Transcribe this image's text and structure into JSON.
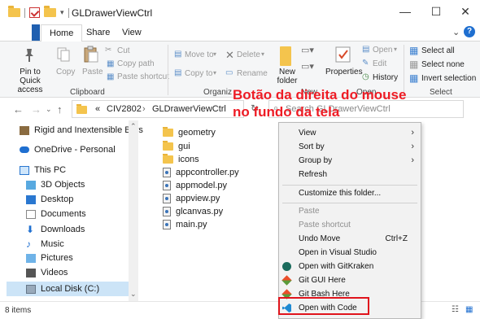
{
  "window": {
    "title": "GLDrawerViewCtrl",
    "controls": [
      "—",
      "☐",
      "✕"
    ]
  },
  "tabs": {
    "home": "Home",
    "share": "Share",
    "view": "View"
  },
  "ribbon": {
    "pin": "Pin to Quick access",
    "copy": "Copy",
    "paste": "Paste",
    "cut": "Cut",
    "copy_path": "Copy path",
    "paste_shortcut": "Paste shortcut",
    "move_to": "Move to",
    "copy_to": "Copy to",
    "delete": "Delete",
    "rename": "Rename",
    "new_folder": "New folder",
    "properties": "Properties",
    "open": "Open",
    "edit": "Edit",
    "history": "History",
    "select_all": "Select all",
    "select_none": "Select none",
    "invert_selection": "Invert selection",
    "group_clipboard": "Clipboard",
    "group_organize": "Organiz",
    "group_new": "New",
    "group_open": "Open",
    "group_select": "Select"
  },
  "address": {
    "prefix": "«",
    "crumbs": [
      "CIV2802",
      "GLDrawerViewCtrl"
    ],
    "search_placeholder": "Search GLDrawerViewCtrl"
  },
  "nav": [
    {
      "label": "Rigid and Inextensible Bars",
      "icon": "bars-folder-icon"
    },
    {
      "label": "OneDrive - Personal",
      "icon": "onedrive-icon"
    },
    {
      "label": "This PC",
      "icon": "pc-icon"
    },
    {
      "label": "3D Objects",
      "icon": "3d-objects-icon"
    },
    {
      "label": "Desktop",
      "icon": "desktop-icon"
    },
    {
      "label": "Documents",
      "icon": "documents-icon"
    },
    {
      "label": "Downloads",
      "icon": "downloads-icon"
    },
    {
      "label": "Music",
      "icon": "music-icon"
    },
    {
      "label": "Pictures",
      "icon": "pictures-icon"
    },
    {
      "label": "Videos",
      "icon": "videos-icon"
    },
    {
      "label": "Local Disk (C:)",
      "icon": "drive-icon"
    }
  ],
  "files": [
    {
      "name": "geometry",
      "kind": "folder"
    },
    {
      "name": "gui",
      "kind": "folder"
    },
    {
      "name": "icons",
      "kind": "folder"
    },
    {
      "name": "appcontroller.py",
      "kind": "py"
    },
    {
      "name": "appmodel.py",
      "kind": "py"
    },
    {
      "name": "appview.py",
      "kind": "py"
    },
    {
      "name": "glcanvas.py",
      "kind": "py"
    },
    {
      "name": "main.py",
      "kind": "py"
    }
  ],
  "status": {
    "items": "8 items"
  },
  "annotation": {
    "line1": "Botão da direita do mouse",
    "line2": "no fundo da tela"
  },
  "context_menu": {
    "view": "View",
    "sort_by": "Sort by",
    "group_by": "Group by",
    "refresh": "Refresh",
    "customize": "Customize this folder...",
    "paste": "Paste",
    "paste_shortcut": "Paste shortcut",
    "undo_move": "Undo Move",
    "undo_shortcut": "Ctrl+Z",
    "open_vs": "Open in Visual Studio",
    "open_gitkraken": "Open with GitKraken",
    "git_gui": "Git GUI Here",
    "git_bash": "Git Bash Here",
    "open_code": "Open with Code"
  },
  "colors": {
    "accent": "#1f5fb0",
    "annotation": "#ee1c25",
    "highlight_box": "#e0141c",
    "selected_nav": "#cce4f7"
  }
}
